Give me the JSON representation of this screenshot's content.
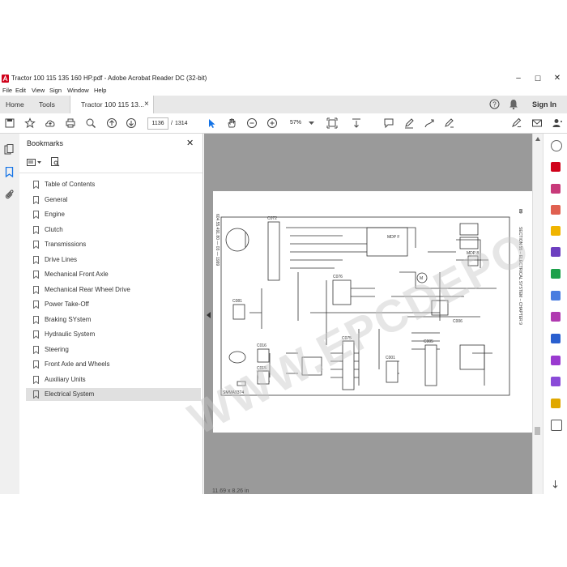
{
  "window": {
    "title": "Tractor 100 115 135 160 HP.pdf - Adobe Acrobat Reader DC (32-bit)",
    "minimize": "–",
    "maximize": "☐",
    "close": "✕"
  },
  "menu": [
    "File",
    "Edit",
    "View",
    "Sign",
    "Window",
    "Help"
  ],
  "tabs": {
    "home": "Home",
    "tools": "Tools",
    "document": "Tractor 100 115 13...",
    "document_close": "×",
    "sign_in": "Sign In"
  },
  "toolbar": {
    "current_page": "1136",
    "page_separator": "/",
    "total_pages": "1314",
    "zoom": "57%"
  },
  "bookmarks": {
    "title": "Bookmarks",
    "close": "✕",
    "items": [
      "Table of Contents",
      "General",
      "Engine",
      "Clutch",
      "Transmissions",
      "Drive Lines",
      "Mechanical Front Axle",
      "Mechanical Rear Wheel Drive",
      "Power Take-Off",
      "Braking SYstem",
      "Hydraulic System",
      "Steering",
      "Front Axle and Wheels",
      "Auxiliary Units",
      "Electrical System"
    ],
    "selected": "Electrical System"
  },
  "document": {
    "side_heading": "SECTION 55 – ELECTRICAL SYSTEM – CHAPTER 9",
    "page_number": "89",
    "side_code": "604.55.491.80 — 03 — 1999",
    "ref_code": "SMMA9374",
    "connectors": [
      "C072",
      "MDP F",
      "MDP 8",
      "C076",
      "C081",
      "C016",
      "C015",
      "C075",
      "C001",
      "C005",
      "C006",
      "M"
    ]
  },
  "watermark": {
    "line1": "WWW.EPCDEPO.COM"
  },
  "status": {
    "page_size": "11.69 x 8.26 in"
  },
  "colors": {
    "acrobat_red": "#d0021b",
    "accent_blue": "#1473e6",
    "doc_background": "#9a9a9a"
  }
}
